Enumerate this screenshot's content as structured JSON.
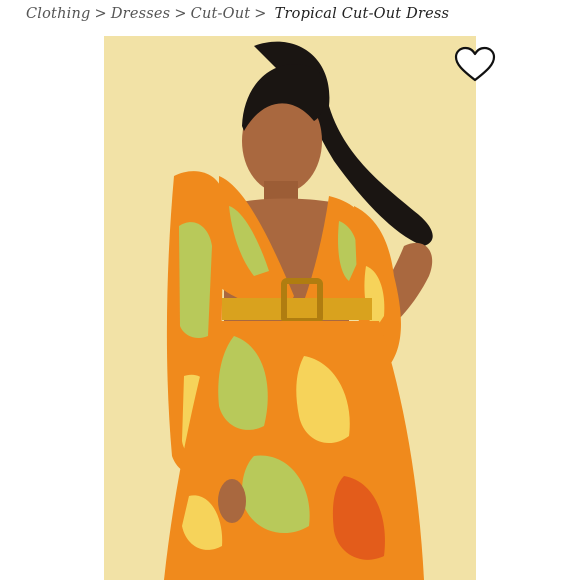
{
  "breadcrumb": {
    "items": [
      "Clothing",
      "Dresses",
      "Cut-Out"
    ],
    "separator": ">",
    "current": "Tropical Cut-Out Dress"
  },
  "product": {
    "image_icon": "product-photo-icon"
  },
  "like": {
    "icon": "heart-outline-icon",
    "color": "#111111"
  },
  "colors": {
    "photo_background": "#f2e2a6",
    "dress_orange": "#f08a1c",
    "dress_green": "#b8c95a",
    "dress_yellow": "#f6d35a",
    "belt_gold": "#d9a21e"
  }
}
